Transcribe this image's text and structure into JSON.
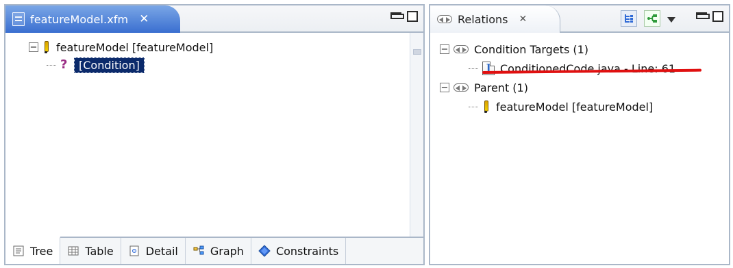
{
  "left_panel": {
    "tab_title": "featureModel.xfm",
    "tree": [
      {
        "label": "featureModel [featureModel]"
      },
      {
        "label": "[Condition]"
      }
    ],
    "bottom_tabs": [
      {
        "label": "Tree"
      },
      {
        "label": "Table"
      },
      {
        "label": "Detail"
      },
      {
        "label": "Graph"
      },
      {
        "label": "Constraints"
      }
    ],
    "icons": {
      "editor_tab": "file-icon",
      "close": "close-icon",
      "feature": "feature-icon",
      "condition": "condition-icon"
    }
  },
  "right_panel": {
    "tab_title": "Relations",
    "toolbar": {
      "icons": [
        "tree-view-icon",
        "graph-view-icon",
        "view-menu-icon",
        "minimize-icon",
        "maximize-icon"
      ]
    },
    "relations": {
      "condition_targets": "Condition Targets (1)",
      "target_item": "ConditionedCode.java - Line: 61",
      "parent": "Parent (1)",
      "parent_item": "featureModel [featureModel]"
    }
  },
  "colors": {
    "editor_tab_accent": "#3a6fd0",
    "selection_bg": "#0b2a6b",
    "annotation_red": "#e01010"
  }
}
